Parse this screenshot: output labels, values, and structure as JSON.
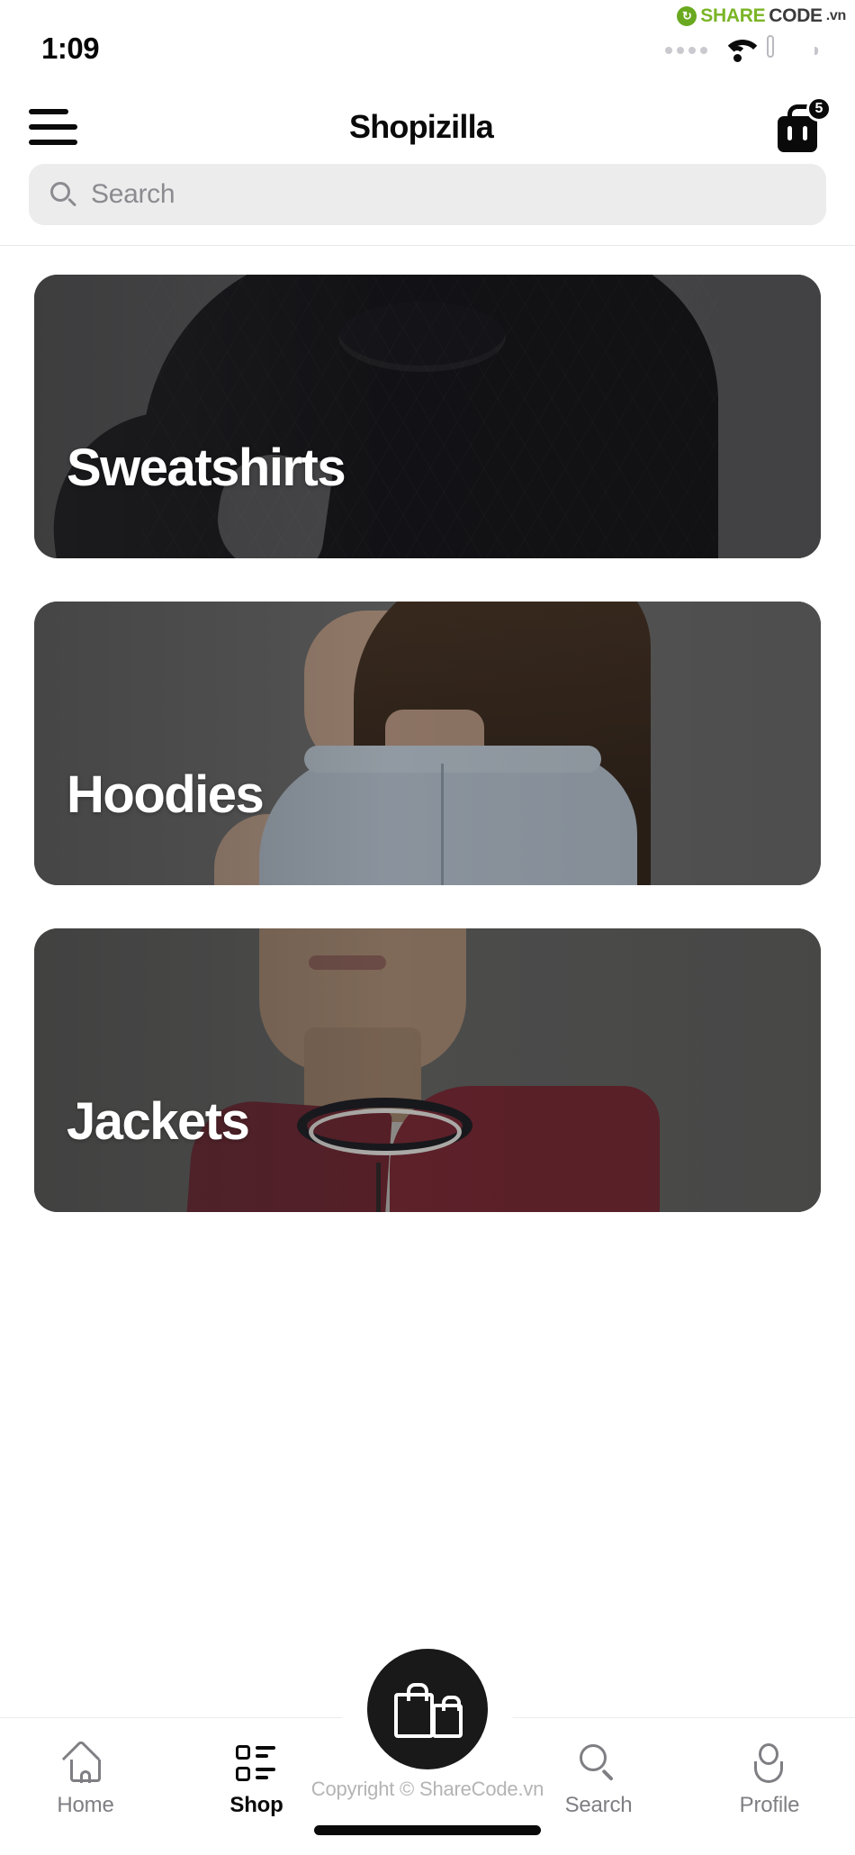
{
  "watermark": {
    "brand_share": "SHARE",
    "brand_code": "CODE",
    "brand_tld": ".vn",
    "logo_glyph": "↻",
    "card_overlay": "ShareCode.vn",
    "copyright": "Copyright © ShareCode.vn",
    "accent_green": "#7ab526"
  },
  "status_bar": {
    "time": "1:09",
    "signal_icon": "signal-dots-icon",
    "wifi_icon": "wifi-icon",
    "battery_icon": "battery-full-icon"
  },
  "header": {
    "menu_icon": "hamburger-menu-icon",
    "title": "Shopizilla",
    "cart_icon": "shopping-bag-icon",
    "cart_badge_count": "5"
  },
  "search": {
    "icon": "search-icon",
    "placeholder": "Search",
    "value": ""
  },
  "categories": [
    {
      "label": "Sweatshirts",
      "artwork": "black-knit-sweater-model"
    },
    {
      "label": "Hoodies",
      "artwork": "woman-back-light-blue-hoodie"
    },
    {
      "label": "Jackets",
      "artwork": "man-maroon-bomber-jacket"
    }
  ],
  "bottom_nav": {
    "items": [
      {
        "label": "Home",
        "icon": "home-icon",
        "active": false
      },
      {
        "label": "Shop",
        "icon": "list-icon",
        "active": true
      },
      {
        "label": "Search",
        "icon": "search-icon",
        "active": false
      },
      {
        "label": "Profile",
        "icon": "person-icon",
        "active": false
      }
    ],
    "fab_icon": "shopping-bags-icon"
  }
}
